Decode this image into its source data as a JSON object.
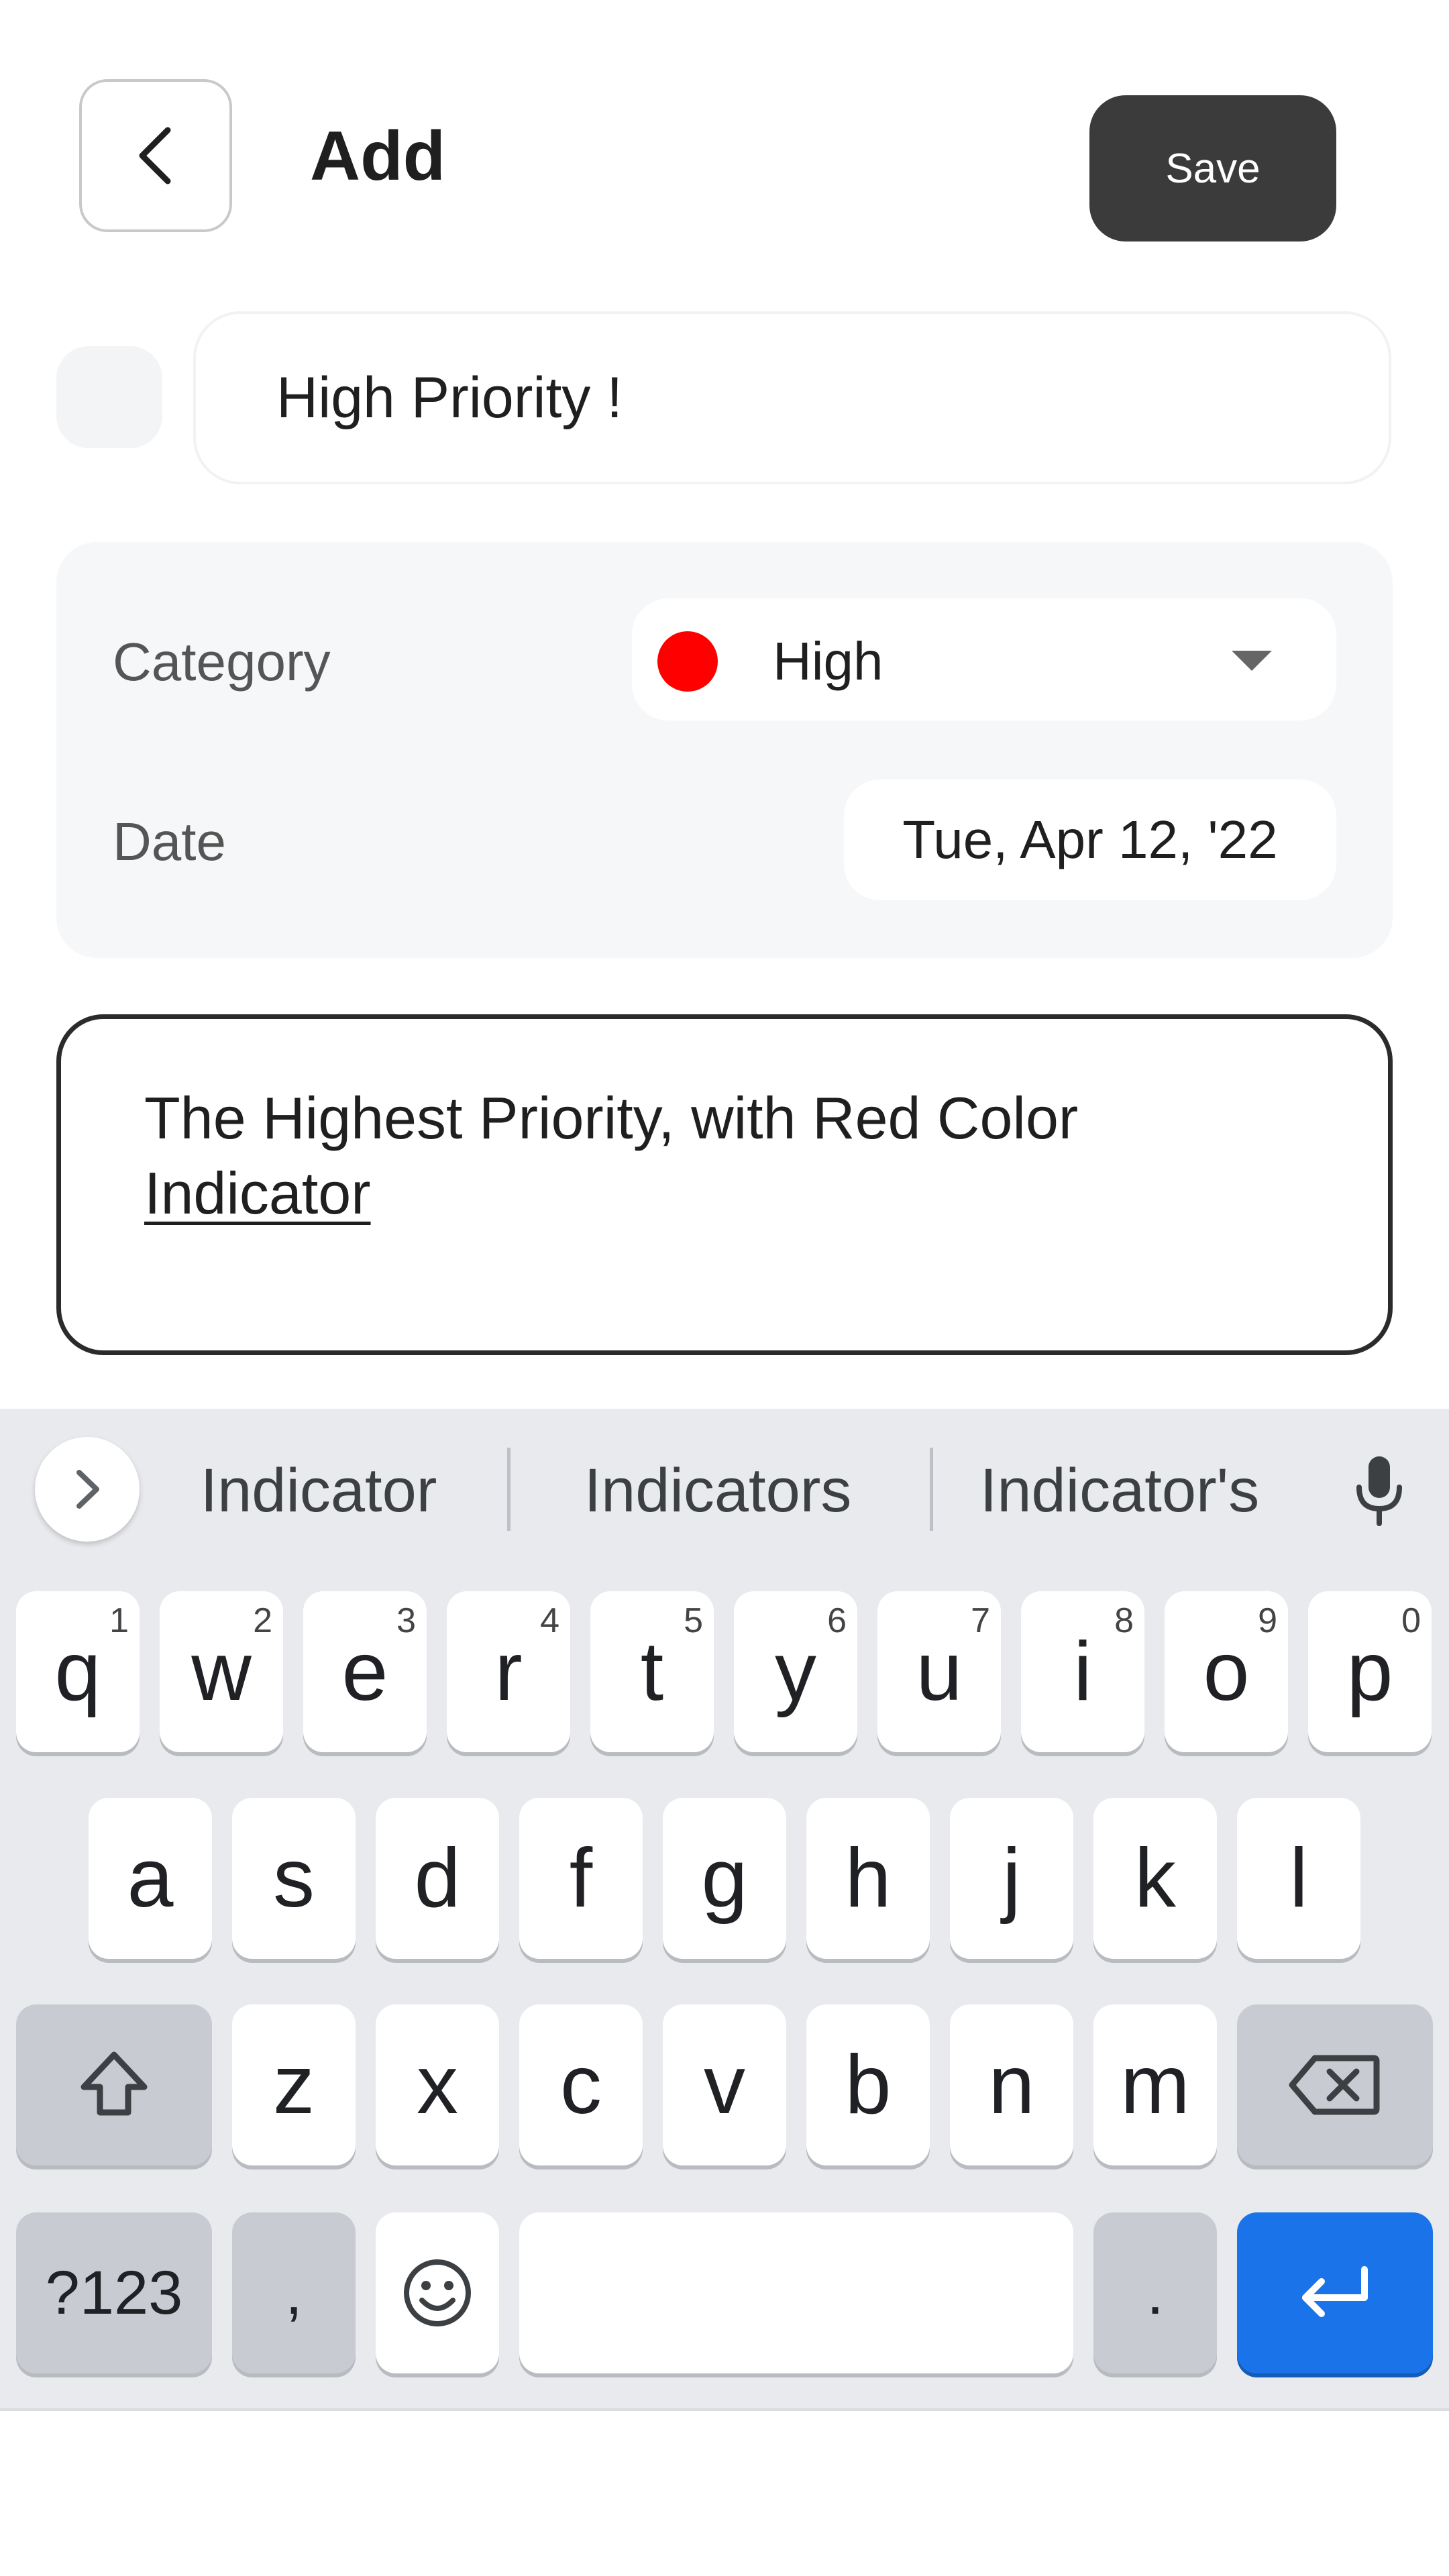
{
  "header": {
    "title": "Add",
    "save_label": "Save"
  },
  "title_input": {
    "value": "High Priority !"
  },
  "details": {
    "category_label": "Category",
    "category_value": "High",
    "category_color": "#ff0000",
    "date_label": "Date",
    "date_value": "Tue, Apr 12, '22"
  },
  "description": {
    "text": "The Highest Priority, with Red Color ",
    "composing_word": "Indicator"
  },
  "keyboard": {
    "suggestions": [
      "Indicator",
      "Indicators",
      "Indicator's"
    ],
    "row1": [
      {
        "key": "q",
        "hint": "1"
      },
      {
        "key": "w",
        "hint": "2"
      },
      {
        "key": "e",
        "hint": "3"
      },
      {
        "key": "r",
        "hint": "4"
      },
      {
        "key": "t",
        "hint": "5"
      },
      {
        "key": "y",
        "hint": "6"
      },
      {
        "key": "u",
        "hint": "7"
      },
      {
        "key": "i",
        "hint": "8"
      },
      {
        "key": "o",
        "hint": "9"
      },
      {
        "key": "p",
        "hint": "0"
      }
    ],
    "row2": [
      "a",
      "s",
      "d",
      "f",
      "g",
      "h",
      "j",
      "k",
      "l"
    ],
    "row3": [
      "z",
      "x",
      "c",
      "v",
      "b",
      "n",
      "m"
    ],
    "symbols_label": "?123",
    "comma_label": ",",
    "period_label": ".",
    "accent_color": "#1a73e8"
  }
}
